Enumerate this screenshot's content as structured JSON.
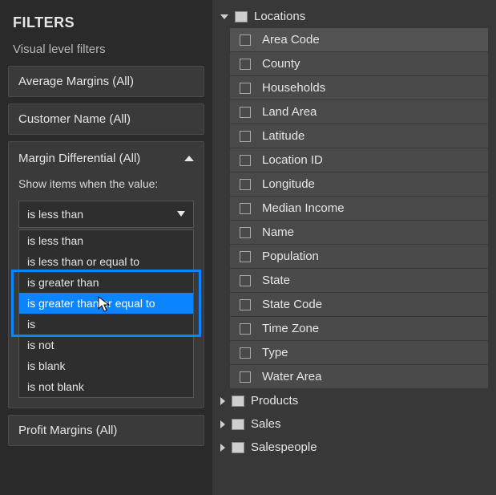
{
  "filters": {
    "title": "FILTERS",
    "subheader": "Visual level filters",
    "cards": [
      {
        "label": "Average Margins",
        "scope": "(All)"
      },
      {
        "label": "Customer Name",
        "scope": "(All)"
      },
      {
        "label": "Margin Differential",
        "scope": "(All)"
      },
      {
        "label": "Profit Margins",
        "scope": "(All)"
      }
    ],
    "expanded": {
      "instruction": "Show items when the value:",
      "selected_option": "is less than",
      "options": [
        "is less than",
        "is less than or equal to",
        "is greater than",
        "is greater than or equal to",
        "is",
        "is not",
        "is blank",
        "is not blank"
      ],
      "hover_index": 3
    }
  },
  "fields": {
    "tables": [
      {
        "name": "Locations",
        "expanded": true,
        "columns": [
          "Area Code",
          "County",
          "Households",
          "Land Area",
          "Latitude",
          "Location ID",
          "Longitude",
          "Median Income",
          "Name",
          "Population",
          "State",
          "State Code",
          "Time Zone",
          "Type",
          "Water Area"
        ]
      },
      {
        "name": "Products",
        "expanded": false,
        "columns": []
      },
      {
        "name": "Sales",
        "expanded": false,
        "columns": []
      },
      {
        "name": "Salespeople",
        "expanded": false,
        "columns": []
      }
    ]
  }
}
